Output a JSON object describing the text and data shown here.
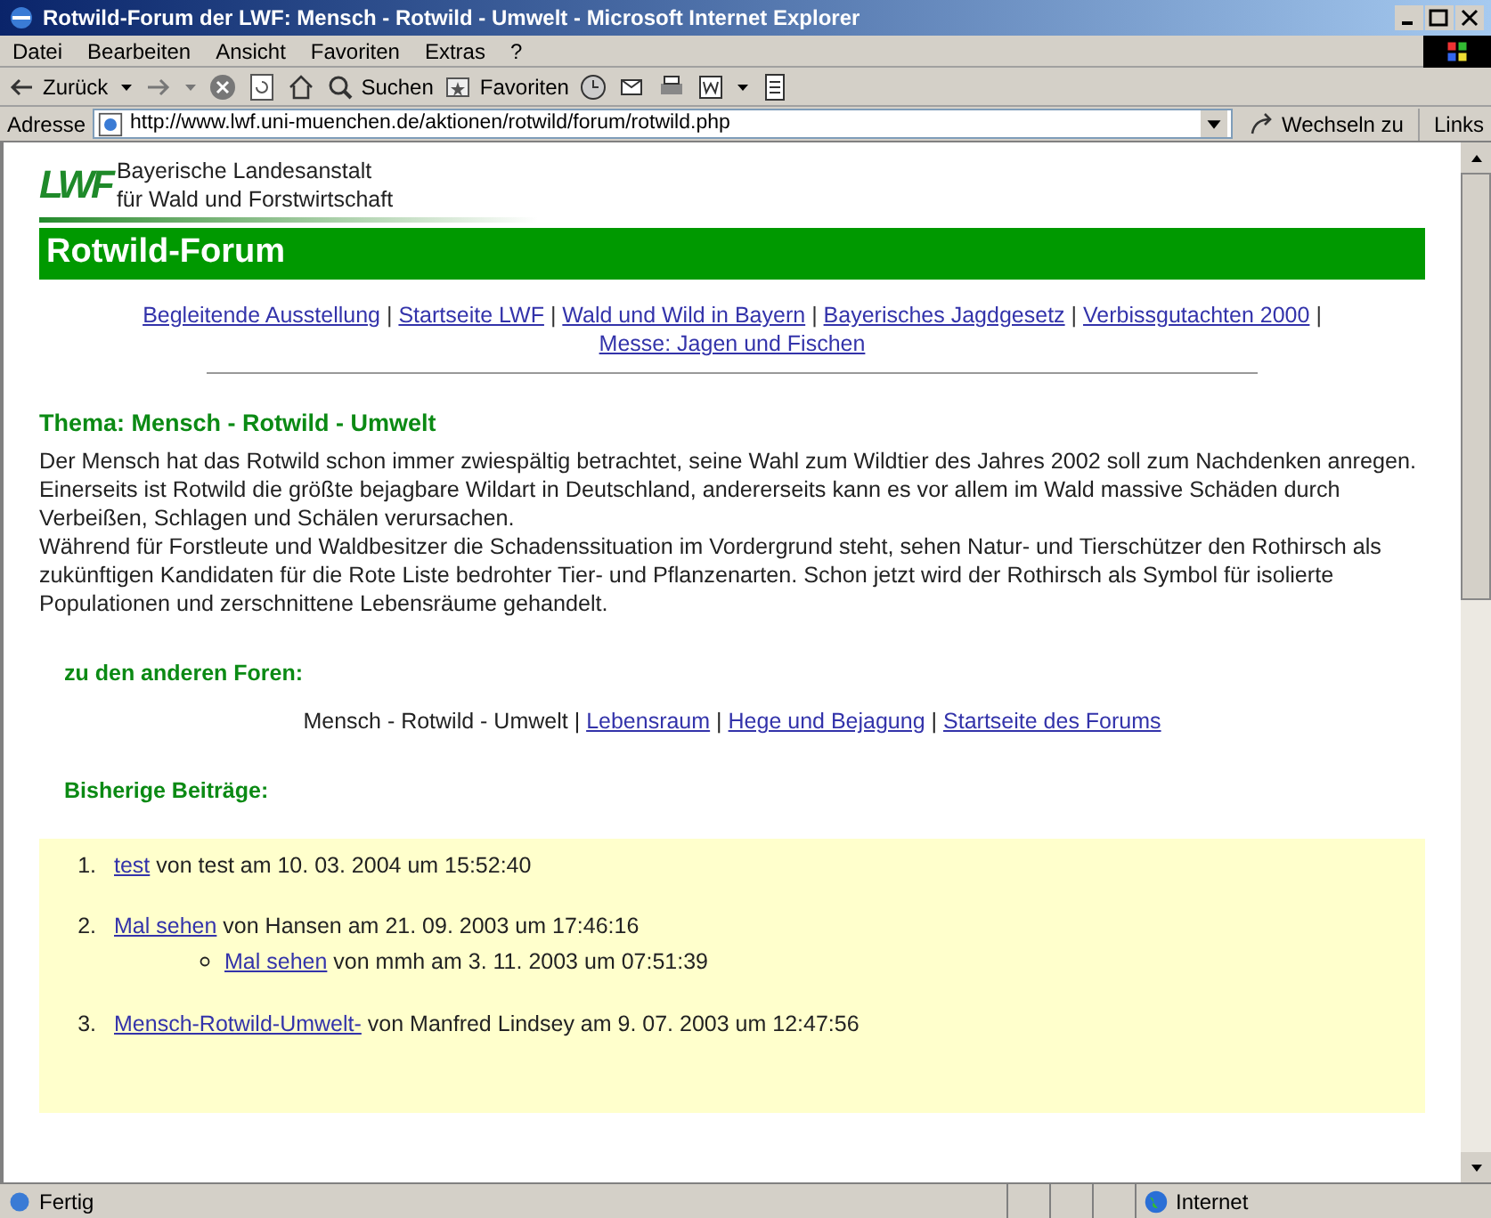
{
  "window": {
    "title": "Rotwild-Forum der LWF: Mensch - Rotwild - Umwelt - Microsoft Internet Explorer"
  },
  "menu": [
    "Datei",
    "Bearbeiten",
    "Ansicht",
    "Favoriten",
    "Extras",
    "?"
  ],
  "toolbar": {
    "back": "Zurück",
    "search": "Suchen",
    "favorites": "Favoriten"
  },
  "address": {
    "label": "Adresse",
    "url": "http://www.lwf.uni-muenchen.de/aktionen/rotwild/forum/rotwild.php",
    "go": "Wechseln zu",
    "links": "Links"
  },
  "page": {
    "logo": "LWF",
    "org": [
      "Bayerische Landesanstalt",
      "für Wald und Forstwirtschaft"
    ],
    "banner": "Rotwild-Forum",
    "separator": "|",
    "nav_links": [
      "Begleitende Ausstellung",
      "Startseite LWF",
      "Wald und Wild in Bayern",
      "Bayerisches Jagdgesetz",
      "Verbissgutachten 2000",
      "Messe: Jagen und Fischen"
    ],
    "topic": "Thema: Mensch - Rotwild - Umwelt",
    "paragraphs": [
      "Der Mensch hat das Rotwild schon immer zwiespältig betrachtet, seine Wahl zum Wildtier des Jahres 2002 soll zum Nachdenken anregen. Einerseits ist Rotwild die größte bejagbare Wildart in Deutschland, andererseits kann es vor allem im Wald massive Schäden durch Verbeißen, Schlagen und Schälen verursachen.",
      "Während für Forstleute und Waldbesitzer die Schadenssituation im Vordergrund steht, sehen Natur- und Tierschützer den Rothirsch als zukünftigen Kandidaten für die Rote Liste bedrohter Tier- und Pflanzenarten. Schon jetzt wird der Rothirsch als Symbol für isolierte Populationen und zerschnittene Lebensräume gehandelt."
    ],
    "forums_heading": "zu den anderen Foren:",
    "forums": [
      {
        "label": "Mensch - Rotwild - Umwelt",
        "selected": true
      },
      {
        "label": "Lebensraum",
        "selected": false
      },
      {
        "label": "Hege und Bejagung",
        "selected": false
      },
      {
        "label": "Startseite des Forums",
        "selected": false
      }
    ],
    "posts_heading": "Bisherige Beiträge:",
    "posts": [
      {
        "number": "1.",
        "title": "test",
        "meta": "von test am 10. 03. 2004 um 15:52:40"
      },
      {
        "number": "2.",
        "title": "Mal sehen",
        "meta": "von Hansen am 21. 09. 2003 um 17:46:16",
        "replies": [
          {
            "title": "Mal sehen",
            "meta": "von mmh am 3. 11. 2003 um 07:51:39"
          }
        ]
      },
      {
        "number": "3.",
        "title": "Mensch-Rotwild-Umwelt-",
        "meta": "von Manfred Lindsey am 9. 07. 2003 um 12:47:56"
      }
    ]
  },
  "status_bar": {
    "text": "Fertig",
    "zone": "Internet"
  }
}
